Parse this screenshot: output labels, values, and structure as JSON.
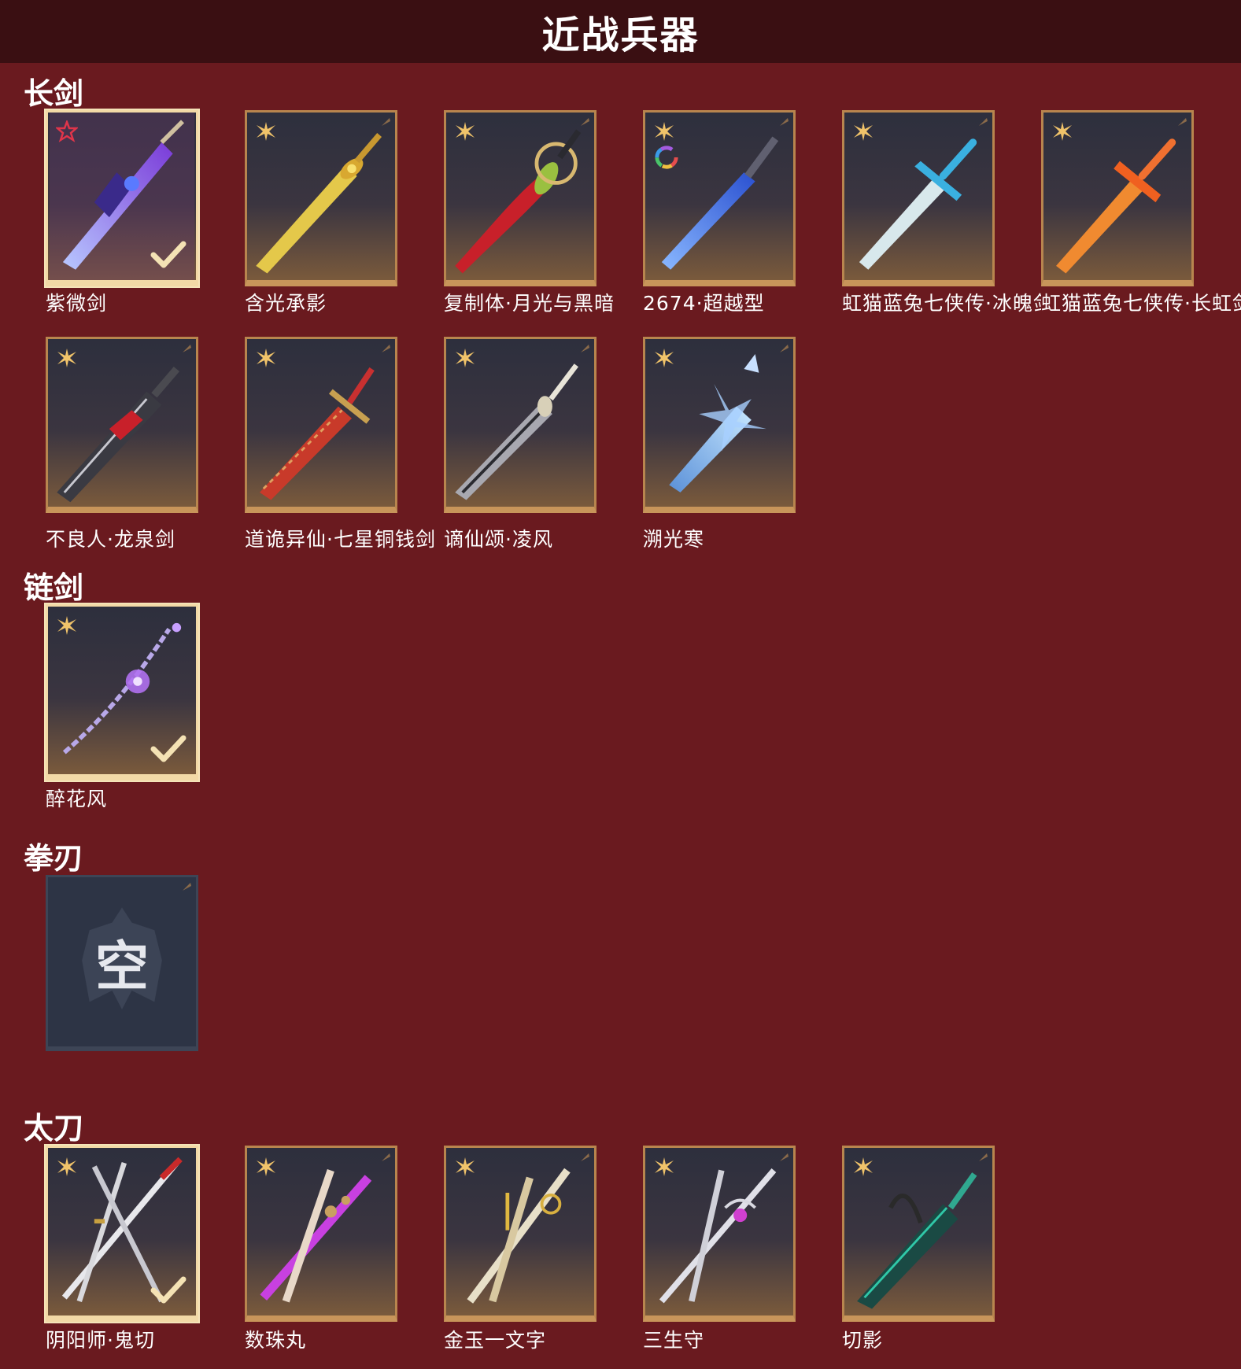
{
  "header": {
    "title": "近战兵器"
  },
  "colors": {
    "background": "#6a1a1f",
    "header": "#3a0f12",
    "card_border": "#b8854e",
    "selected_border": "#f2d9a6"
  },
  "sections": {
    "longsword": {
      "title": "长剑",
      "items": [
        {
          "name": "紫微剑",
          "badge": "red-star-icon",
          "selected": true
        },
        {
          "name": "含光承影",
          "badge": "gold-star-icon"
        },
        {
          "name": "复制体·月光与黑暗",
          "badge": "gold-star-icon"
        },
        {
          "name": "2674·超越型",
          "badge": "rainbow-ring-icon"
        },
        {
          "name": "虹猫蓝兔七侠传·冰魄剑",
          "badge": "gold-star-icon"
        },
        {
          "name": "虹猫蓝兔七侠传·长虹剑",
          "badge": "gold-star-icon"
        },
        {
          "name": "不良人·龙泉剑",
          "badge": "gold-star-icon"
        },
        {
          "name": "道诡异仙·七星铜钱剑",
          "badge": "gold-star-icon"
        },
        {
          "name": "谪仙颂·凌风",
          "badge": "gold-star-icon"
        },
        {
          "name": "溯光寒",
          "badge": "gold-star-icon"
        }
      ]
    },
    "chainsword": {
      "title": "链剑",
      "items": [
        {
          "name": "醉花风",
          "badge": "gold-star-icon",
          "selected": true
        }
      ]
    },
    "fistblade": {
      "title": "拳刃",
      "empty_label": "空"
    },
    "katana": {
      "title": "太刀",
      "items": [
        {
          "name": "阴阳师·鬼切",
          "badge": "gold-star-icon",
          "selected": true
        },
        {
          "name": "数珠丸",
          "badge": "gold-star-icon"
        },
        {
          "name": "金玉一文字",
          "badge": "gold-star-icon"
        },
        {
          "name": "三生守",
          "badge": "gold-star-icon"
        },
        {
          "name": "切影",
          "badge": "gold-star-icon"
        }
      ]
    }
  }
}
